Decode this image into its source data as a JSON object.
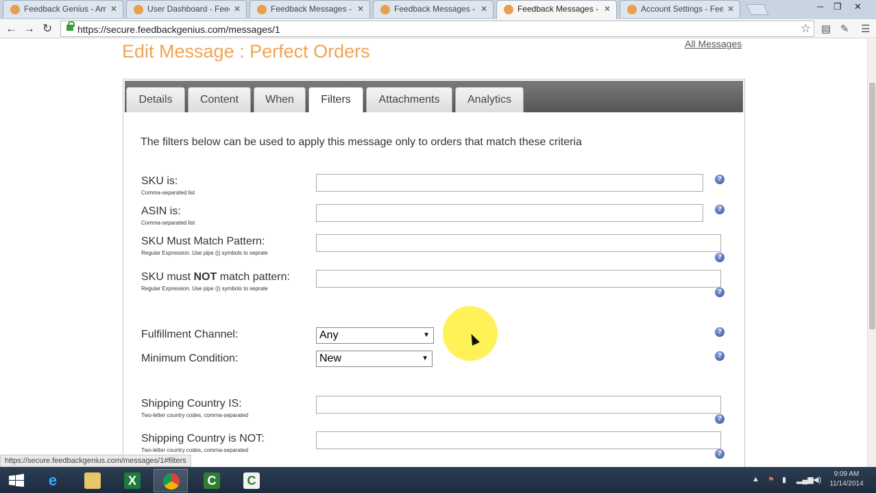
{
  "browser": {
    "tabs": [
      {
        "label": "Feedback Genius - Amaz"
      },
      {
        "label": "User Dashboard - Feedbac"
      },
      {
        "label": "Feedback Messages - Feec"
      },
      {
        "label": "Feedback Messages - Feec"
      },
      {
        "label": "Feedback Messages - Feec",
        "active": true
      },
      {
        "label": "Account Settings - Feedb"
      }
    ],
    "url": "https://secure.feedbackgenius.com/messages/1",
    "status_url": "https://secure.feedbackgenius.com/messages/1#filters"
  },
  "page": {
    "title": "Edit Message : Perfect Orders",
    "all_messages_link": "All Messages",
    "tabs": [
      "Details",
      "Content",
      "When",
      "Filters",
      "Attachments",
      "Analytics"
    ],
    "active_tab": "Filters",
    "intro": "The filters below can be used to apply this message only to orders that match these criteria",
    "filters": {
      "sku": {
        "label": "SKU is:",
        "hint": "Comma-separated list",
        "value": ""
      },
      "asin": {
        "label": "ASIN is:",
        "hint": "Comma-separated list",
        "value": ""
      },
      "sku_match": {
        "label": "SKU Must Match Pattern:",
        "hint": "Regular Expression. Use pipe (|) symbols to seprate",
        "value": ""
      },
      "sku_not_match": {
        "label_pre": "SKU must ",
        "label_bold": "NOT",
        "label_post": " match pattern:",
        "hint": "Regular Expression. Use pipe (|) symbols to seprate",
        "value": ""
      },
      "fulfillment": {
        "label": "Fulfillment Channel:",
        "selected": "Any"
      },
      "condition": {
        "label": "Minimum Condition:",
        "selected": "New"
      },
      "ship_is": {
        "label": "Shipping Country IS:",
        "hint": "Two-letter country codes, comma-separated",
        "value": ""
      },
      "ship_not": {
        "label": "Shipping Country is NOT:",
        "hint": "Two-letter country codes, comma-separated",
        "value": ""
      }
    }
  },
  "taskbar": {
    "clock_time": "9:09 AM",
    "clock_date": "11/14/2014"
  },
  "icons": {
    "help": "question-circle-icon",
    "windows": "windows-start-icon",
    "ie": "internet-explorer-icon",
    "explorer": "file-explorer-icon",
    "excel": "excel-icon",
    "chrome": "chrome-icon",
    "camtasia": "camtasia-icon"
  },
  "colors": {
    "title_orange": "#f0a352",
    "taskbar": "#1d2b3c",
    "help_blue": "#3a4f9a"
  }
}
